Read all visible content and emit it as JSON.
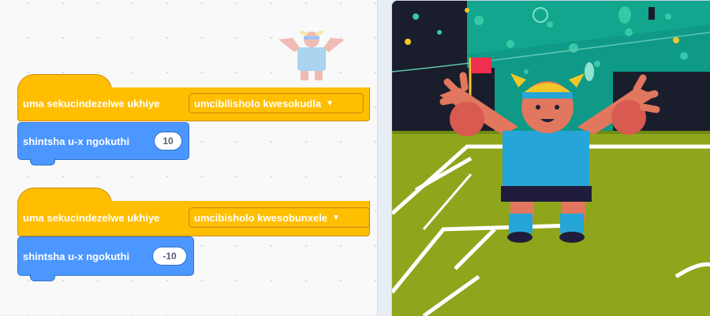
{
  "scripts": [
    {
      "hat": {
        "label": "uma sekucindezelwe ukhiye",
        "key": "umcibilisholo kwesokudla"
      },
      "action": {
        "label": "shintsha u-x ngokuthi",
        "value": "10"
      }
    },
    {
      "hat": {
        "label": "uma sekucindezelwe ukhiye",
        "key": "umcibisholo kwesobunxele"
      },
      "action": {
        "label": "shintsha u-x ngokuthi",
        "value": "-10"
      }
    }
  ],
  "icons": {
    "dropdown": "chevron-down-icon",
    "sprite": "goalkeeper-sprite-thumbnail",
    "flag": "corner-flag-icon"
  },
  "colors": {
    "events": "#ffbf00",
    "motion": "#4c97ff",
    "pitch": "#8fa51c",
    "stands": "#0e9a86"
  }
}
